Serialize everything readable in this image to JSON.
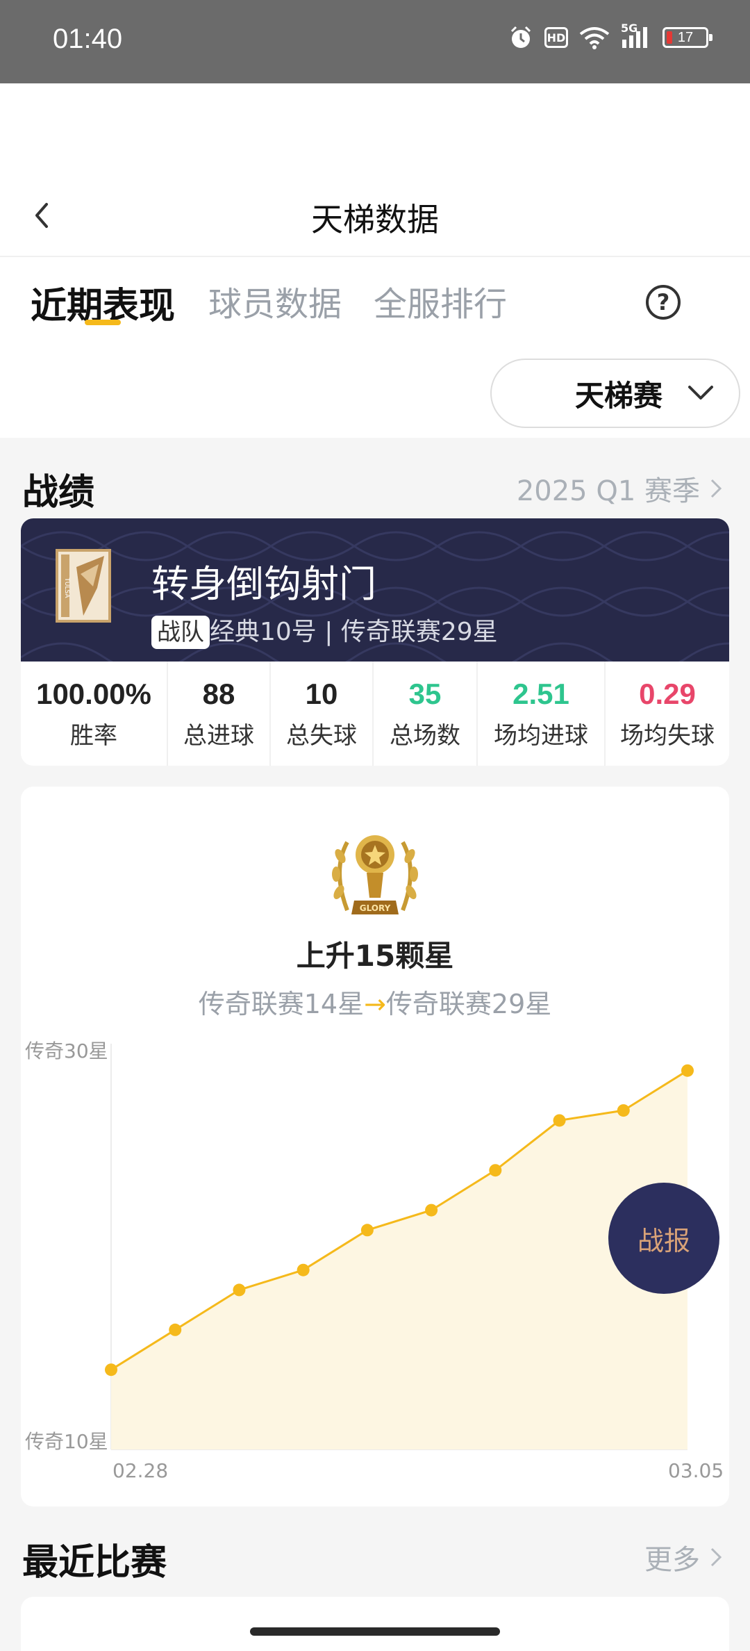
{
  "status_bar": {
    "time": "01:40",
    "hd_badge": "HD",
    "network": "5G",
    "battery": "17",
    "icons": [
      "alarm-icon",
      "wifi-icon",
      "signal-icon",
      "battery-icon"
    ]
  },
  "nav": {
    "title": "天梯数据",
    "back_icon": "chevron-left-icon"
  },
  "tabs": [
    {
      "label": "近期表现",
      "active": true
    },
    {
      "label": "球员数据",
      "active": false
    },
    {
      "label": "全服排行",
      "active": false
    }
  ],
  "help_icon": "?",
  "mode_select": {
    "selected": "天梯赛"
  },
  "record": {
    "title": "战绩",
    "season": "2025 Q1 赛季",
    "team": {
      "name": "转身倒钩射门",
      "tag": "战队",
      "subtitle": "经典10号 | 传奇联赛29星",
      "logo_text": "TULSA"
    },
    "stats": [
      {
        "value": "100.00%",
        "label": "胜率",
        "color": "#222222"
      },
      {
        "value": "88",
        "label": "总进球",
        "color": "#222222"
      },
      {
        "value": "10",
        "label": "总失球",
        "color": "#222222"
      },
      {
        "value": "35",
        "label": "总场数",
        "color": "#2ec58e"
      },
      {
        "value": "2.51",
        "label": "场均进球",
        "color": "#2ec58e"
      },
      {
        "value": "0.29",
        "label": "场均失球",
        "color": "#e8466a"
      }
    ],
    "trophy_text": "GLORY",
    "rise_text": "上升15颗星",
    "range_from": "传奇联赛14星",
    "range_arrow": "→",
    "range_to": "传奇联赛29星"
  },
  "chart_data": {
    "type": "area",
    "y_top_label": "传奇30星",
    "y_bottom_label": "传奇10星",
    "x_start_label": "02.28",
    "x_end_label": "03.05",
    "ylim": [
      10,
      30
    ],
    "values": [
      14,
      16,
      18,
      19,
      21,
      22,
      24,
      26.5,
      27,
      29
    ],
    "accent": "#f5b91b"
  },
  "fab": {
    "label": "战报"
  },
  "recent": {
    "title": "最近比赛",
    "more": "更多"
  }
}
